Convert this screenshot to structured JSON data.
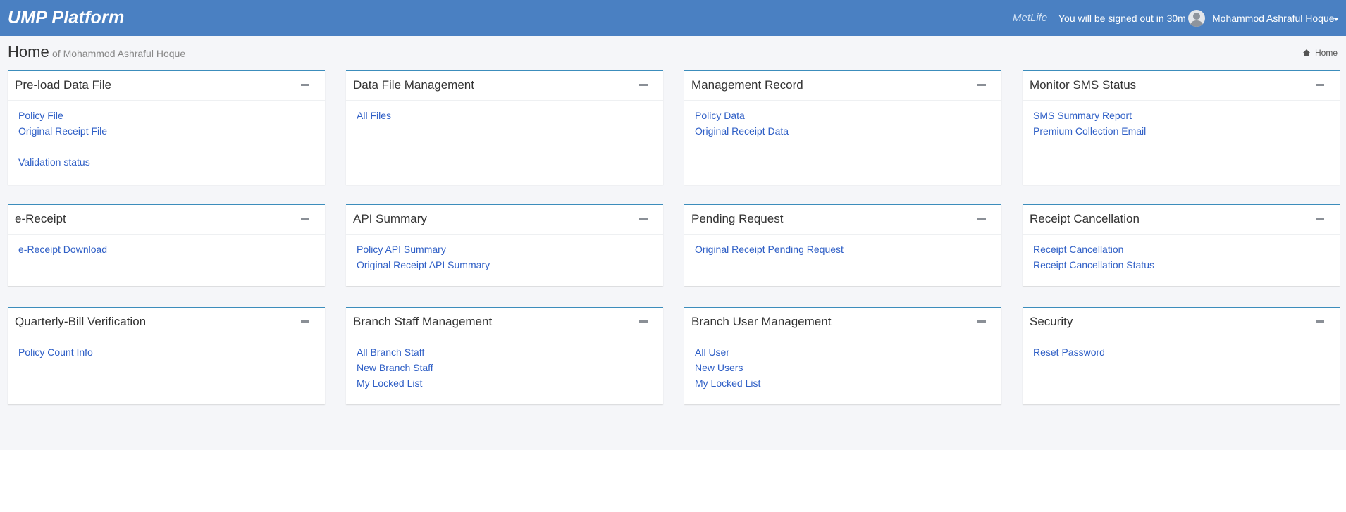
{
  "header": {
    "brand": "UMP Platform",
    "metlife": "MetLife",
    "signout_notice": "You will be signed out in 30m",
    "user_name": "Mohammod Ashraful Hoque"
  },
  "page": {
    "title": "Home",
    "subtitle": "of Mohammod Ashraful Hoque",
    "breadcrumb": "Home"
  },
  "boxes": [
    {
      "title": "Pre-load Data File",
      "links": [
        "Policy File",
        "Original Receipt File",
        "Validation status"
      ]
    },
    {
      "title": "Data File Management",
      "links": [
        "All Files"
      ]
    },
    {
      "title": "Management Record",
      "links": [
        "Policy Data",
        "Original Receipt Data"
      ]
    },
    {
      "title": "Monitor SMS Status",
      "links": [
        "SMS Summary Report",
        "Premium Collection Email"
      ]
    },
    {
      "title": "e-Receipt",
      "links": [
        "e-Receipt Download"
      ]
    },
    {
      "title": "API Summary",
      "links": [
        "Policy API Summary",
        "Original Receipt API Summary"
      ]
    },
    {
      "title": "Pending Request",
      "links": [
        "Original Receipt Pending Request"
      ]
    },
    {
      "title": "Receipt Cancellation",
      "links": [
        "Receipt Cancellation",
        "Receipt Cancellation Status"
      ]
    },
    {
      "title": "Quarterly-Bill Verification",
      "links": [
        "Policy Count Info"
      ]
    },
    {
      "title": "Branch Staff Management",
      "links": [
        "All Branch Staff",
        "New Branch Staff",
        "My Locked List"
      ]
    },
    {
      "title": "Branch User Management",
      "links": [
        "All User",
        "New Users",
        "My Locked List"
      ]
    },
    {
      "title": "Security",
      "links": [
        "Reset Password"
      ]
    }
  ]
}
